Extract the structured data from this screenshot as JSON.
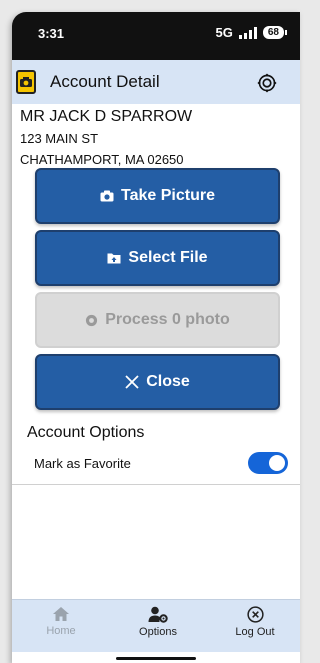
{
  "status_bar": {
    "time": "3:31",
    "network": "5G",
    "battery": "68"
  },
  "app_bar": {
    "title": "Account Detail",
    "logo_icon": "camera-icon",
    "settings_icon": "gear-icon"
  },
  "account": {
    "name": "MR JACK D SPARROW",
    "address_line1": "123 MAIN ST",
    "address_line2": "CHATHAMPORT, MA 02650"
  },
  "actions": {
    "take_picture": "Take Picture",
    "select_file": "Select File",
    "process": "Process 0 photo",
    "close": "Close"
  },
  "account_options": {
    "title": "Account Options",
    "favorite_label": "Mark as Favorite",
    "favorite_on": true
  },
  "bottom_nav": {
    "home": "Home",
    "options": "Options",
    "logout": "Log Out"
  },
  "colors": {
    "primary_button": "#245ea5",
    "app_bar": "#d7e4f5",
    "toggle_on": "#1565d8",
    "disabled_button": "#dcdcdc"
  }
}
